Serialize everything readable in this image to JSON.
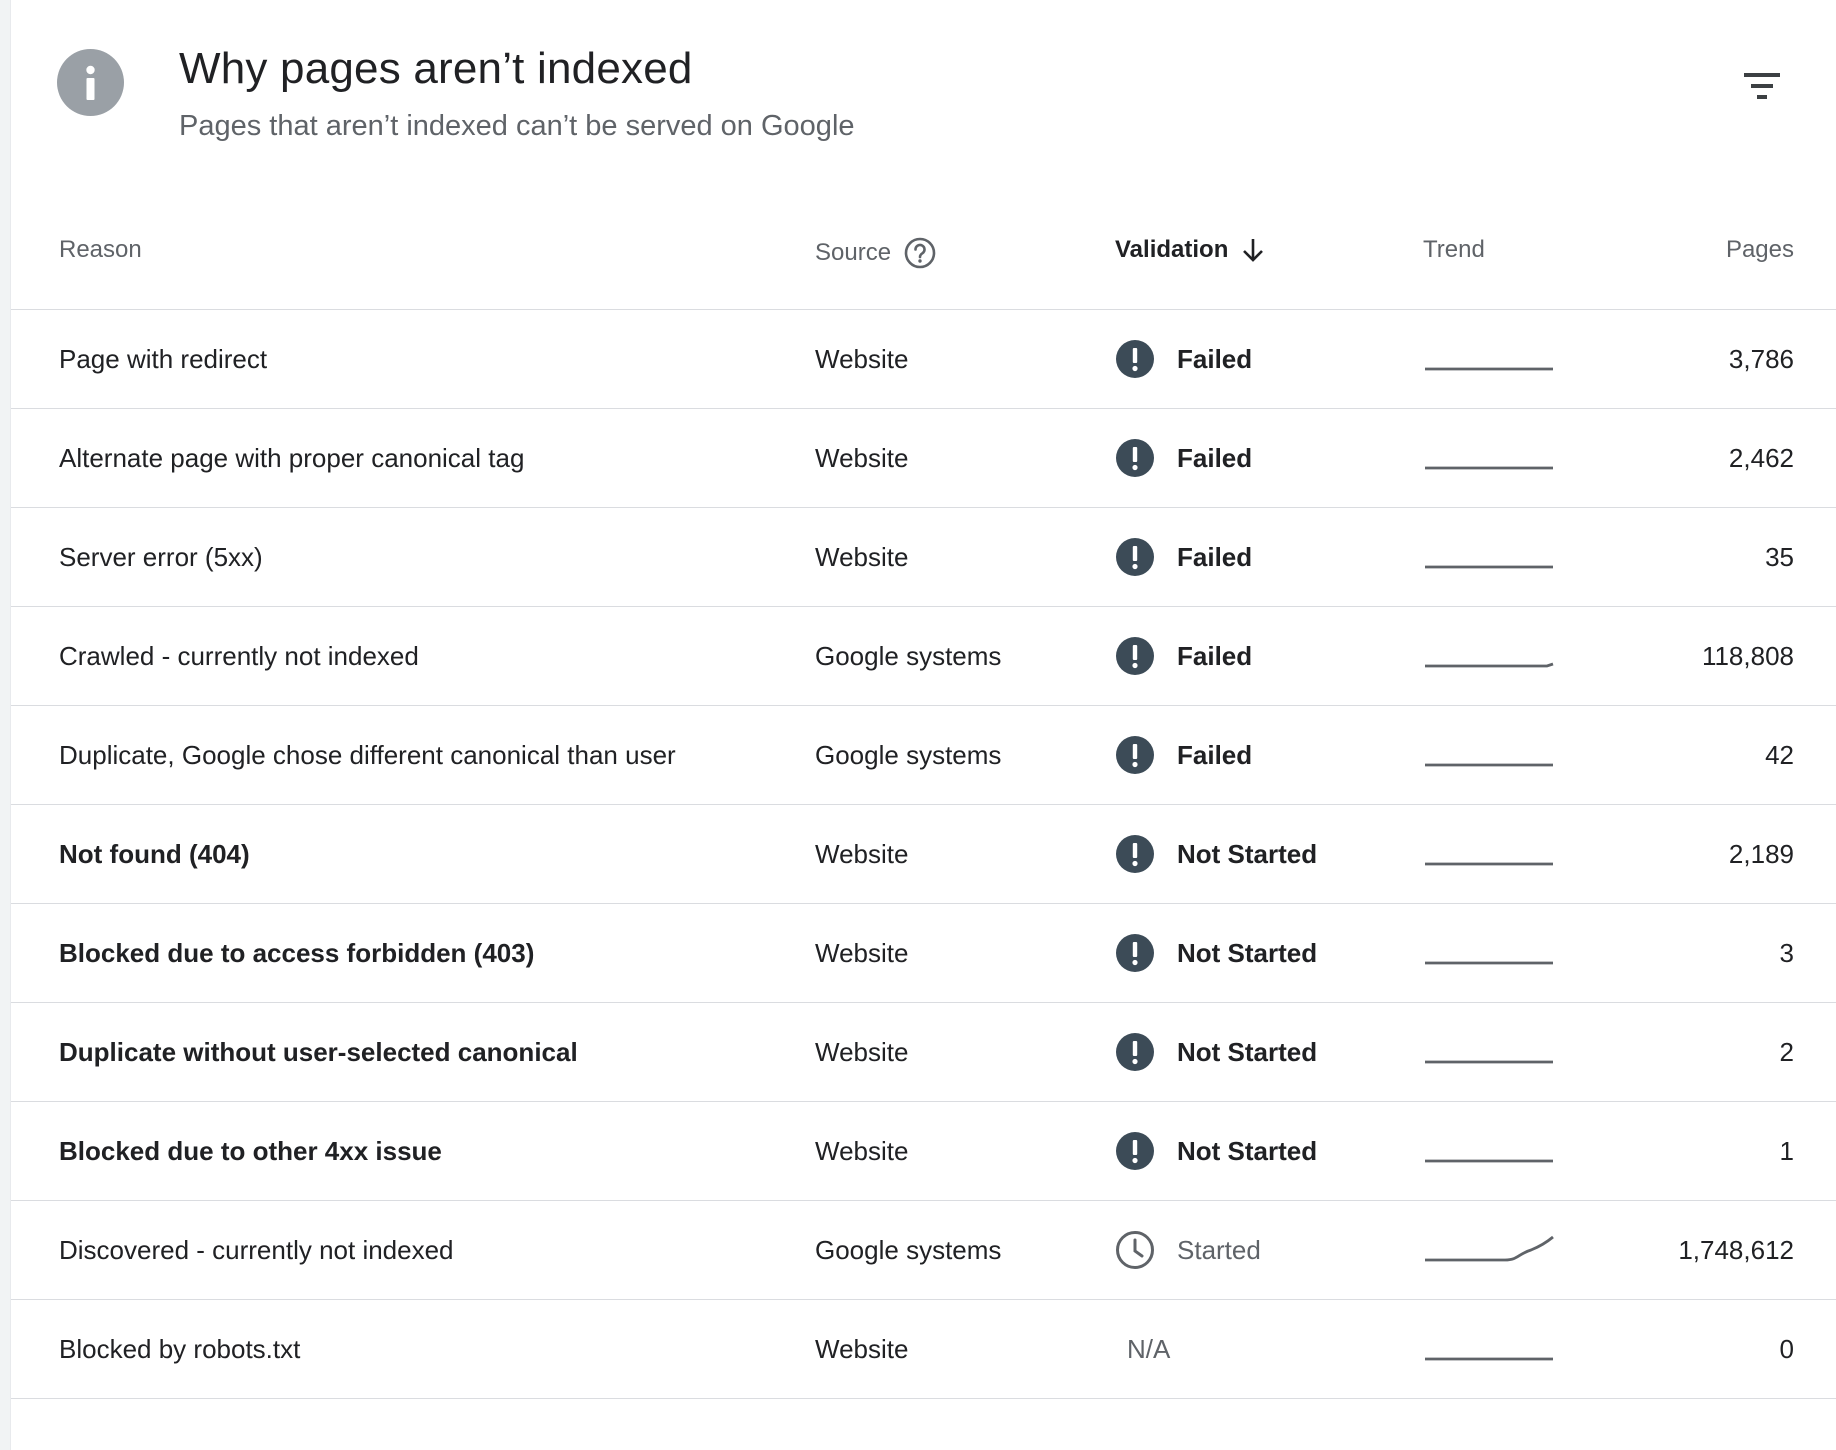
{
  "header": {
    "title": "Why pages aren’t indexed",
    "subtitle": "Pages that aren’t indexed can’t be served on Google",
    "info_icon": "info-icon",
    "filter_icon": "filter-icon"
  },
  "columns": {
    "reason": "Reason",
    "source": "Source",
    "validation": "Validation",
    "trend": "Trend",
    "pages": "Pages"
  },
  "colors": {
    "failed_icon": "#3c4b57",
    "trend_line": "#5f6368",
    "divider": "#dadce0"
  },
  "rows": [
    {
      "reason": "Page with redirect",
      "source": "Website",
      "validation": "Failed",
      "status_icon": "error-icon",
      "trend": "flat",
      "pages": "3,786",
      "bold": false
    },
    {
      "reason": "Alternate page with proper canonical tag",
      "source": "Website",
      "validation": "Failed",
      "status_icon": "error-icon",
      "trend": "flat",
      "pages": "2,462",
      "bold": false
    },
    {
      "reason": "Server error (5xx)",
      "source": "Website",
      "validation": "Failed",
      "status_icon": "error-icon",
      "trend": "flat",
      "pages": "35",
      "bold": false
    },
    {
      "reason": "Crawled - currently not indexed",
      "source": "Google systems",
      "validation": "Failed",
      "status_icon": "error-icon",
      "trend": "slight-up",
      "pages": "118,808",
      "bold": false
    },
    {
      "reason": "Duplicate, Google chose different canonical than user",
      "source": "Google systems",
      "validation": "Failed",
      "status_icon": "error-icon",
      "trend": "flat",
      "pages": "42",
      "bold": false
    },
    {
      "reason": "Not found (404)",
      "source": "Website",
      "validation": "Not Started",
      "status_icon": "error-icon",
      "trend": "flat",
      "pages": "2,189",
      "bold": true
    },
    {
      "reason": "Blocked due to access forbidden (403)",
      "source": "Website",
      "validation": "Not Started",
      "status_icon": "error-icon",
      "trend": "flat",
      "pages": "3",
      "bold": true
    },
    {
      "reason": "Duplicate without user-selected canonical",
      "source": "Website",
      "validation": "Not Started",
      "status_icon": "error-icon",
      "trend": "flat",
      "pages": "2",
      "bold": true
    },
    {
      "reason": "Blocked due to other 4xx issue",
      "source": "Website",
      "validation": "Not Started",
      "status_icon": "error-icon",
      "trend": "flat",
      "pages": "1",
      "bold": true
    },
    {
      "reason": "Discovered - currently not indexed",
      "source": "Google systems",
      "validation": "Started",
      "status_icon": "clock-icon",
      "trend": "rising",
      "pages": "1,748,612",
      "bold": false
    },
    {
      "reason": "Blocked by robots.txt",
      "source": "Website",
      "validation": "N/A",
      "status_icon": "none",
      "trend": "flat",
      "pages": "0",
      "bold": false
    }
  ]
}
